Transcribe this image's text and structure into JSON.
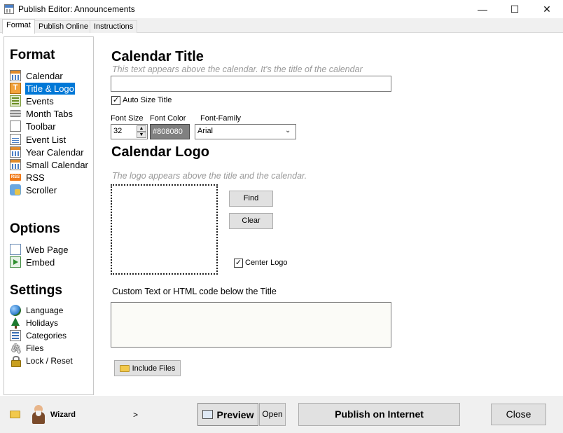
{
  "window": {
    "title": "Publish Editor: Announcements",
    "controls": {
      "minimize": "—",
      "maximize": "☐",
      "close": "✕"
    }
  },
  "tabs": [
    {
      "label": "Format",
      "active": true
    },
    {
      "label": "Publish Online",
      "active": false
    },
    {
      "label": "Instructions",
      "active": false
    }
  ],
  "sidebar": {
    "format_heading": "Format",
    "format_items": [
      {
        "label": "Calendar",
        "icon": "calendar-icon"
      },
      {
        "label": "Title & Logo",
        "icon": "title-logo-icon",
        "selected": true
      },
      {
        "label": "Events",
        "icon": "events-icon"
      },
      {
        "label": "Month Tabs",
        "icon": "month-tabs-icon"
      },
      {
        "label": "Toolbar",
        "icon": "toolbar-icon"
      },
      {
        "label": "Event List",
        "icon": "event-list-icon"
      },
      {
        "label": "Year Calendar",
        "icon": "year-calendar-icon"
      },
      {
        "label": "Small Calendar",
        "icon": "small-calendar-icon"
      },
      {
        "label": "RSS",
        "icon": "rss-icon"
      },
      {
        "label": "Scroller",
        "icon": "scroller-icon"
      }
    ],
    "options_heading": "Options",
    "options_items": [
      {
        "label": "Web Page",
        "icon": "web-page-icon"
      },
      {
        "label": "Embed",
        "icon": "embed-icon"
      }
    ],
    "settings_heading": "Settings",
    "settings_items": [
      {
        "label": "Language",
        "icon": "globe-icon"
      },
      {
        "label": "Holidays",
        "icon": "tree-icon"
      },
      {
        "label": "Categories",
        "icon": "categories-icon"
      },
      {
        "label": "Files",
        "icon": "paperclip-icon"
      },
      {
        "label": "Lock / Reset",
        "icon": "lock-icon"
      }
    ]
  },
  "main": {
    "calendar_title": {
      "heading": "Calendar Title",
      "hint": "This text appears above the calendar.  It's the title of the calendar",
      "value": "",
      "auto_size_label": "Auto Size Title",
      "auto_size_checked": true
    },
    "font": {
      "size_label": "Font Size",
      "size_value": "32",
      "color_label": "Font Color",
      "color_value": "#808080",
      "family_label": "Font-Family",
      "family_value": "Arial"
    },
    "logo": {
      "heading": "Calendar Logo",
      "hint": "The logo appears above the title and the calendar.",
      "find_label": "Find",
      "clear_label": "Clear",
      "center_label": "Center Logo",
      "center_checked": true
    },
    "custom": {
      "label": "Custom Text or HTML code below the Title",
      "value": "",
      "include_files_label": "Include Files"
    }
  },
  "bottom": {
    "wizard_label": "Wizard",
    "wizard_arrow": ">",
    "preview_label": "Preview",
    "open_label": "Open",
    "publish_label": "Publish on Internet",
    "close_label": "Close"
  },
  "colors": {
    "accent": "#0078d7",
    "font_color_swatch": "#808080"
  }
}
